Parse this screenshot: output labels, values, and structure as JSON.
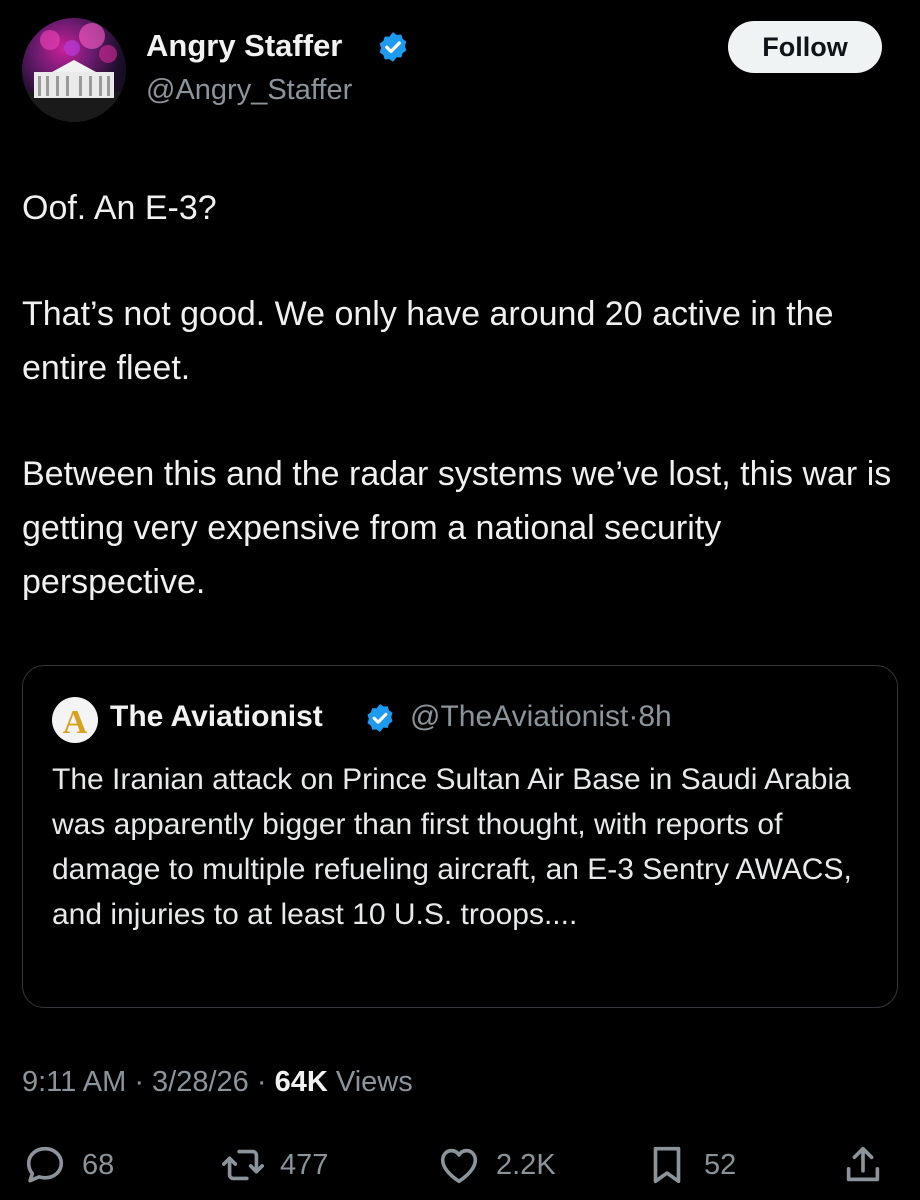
{
  "author": {
    "display_name": "Angry Staffer",
    "handle": "@Angry_Staffer",
    "verified": true
  },
  "follow_button": {
    "label": "Follow"
  },
  "tweet": {
    "paragraphs": [
      "Oof. An E-3?",
      "That’s not good. We only have around 20 active in the entire fleet.",
      "Between this and the radar systems we’ve lost, this war is getting very expensive from a national security perspective."
    ]
  },
  "quoted_tweet": {
    "display_name": "The Aviationist",
    "verified": true,
    "handle": "@TheAviationist",
    "separator": "·",
    "age": "8h",
    "avatar_letter": "A",
    "text": "The Iranian attack on Prince Sultan Air Base in Saudi Arabia was apparently bigger than first thought, with reports of damage to multiple refueling aircraft, an E-3 Sentry AWACS, and injuries to at least 10 U.S. troops...."
  },
  "meta": {
    "time": "9:11 AM",
    "date": "3/28/26",
    "separator": "·",
    "views_count": "64K",
    "views_label": "Views"
  },
  "actions": {
    "replies": "68",
    "reposts": "477",
    "likes": "2.2K",
    "bookmarks": "52"
  },
  "colors": {
    "background": "#000000",
    "text": "#e7e9ea",
    "secondary_text": "#8b949b",
    "verified_badge": "#1d9bf0",
    "follow_button_bg": "#eff3f4",
    "card_border": "#333639"
  },
  "icons": [
    "verified-badge-icon",
    "reply-icon",
    "repost-icon",
    "like-icon",
    "bookmark-icon",
    "share-icon"
  ]
}
